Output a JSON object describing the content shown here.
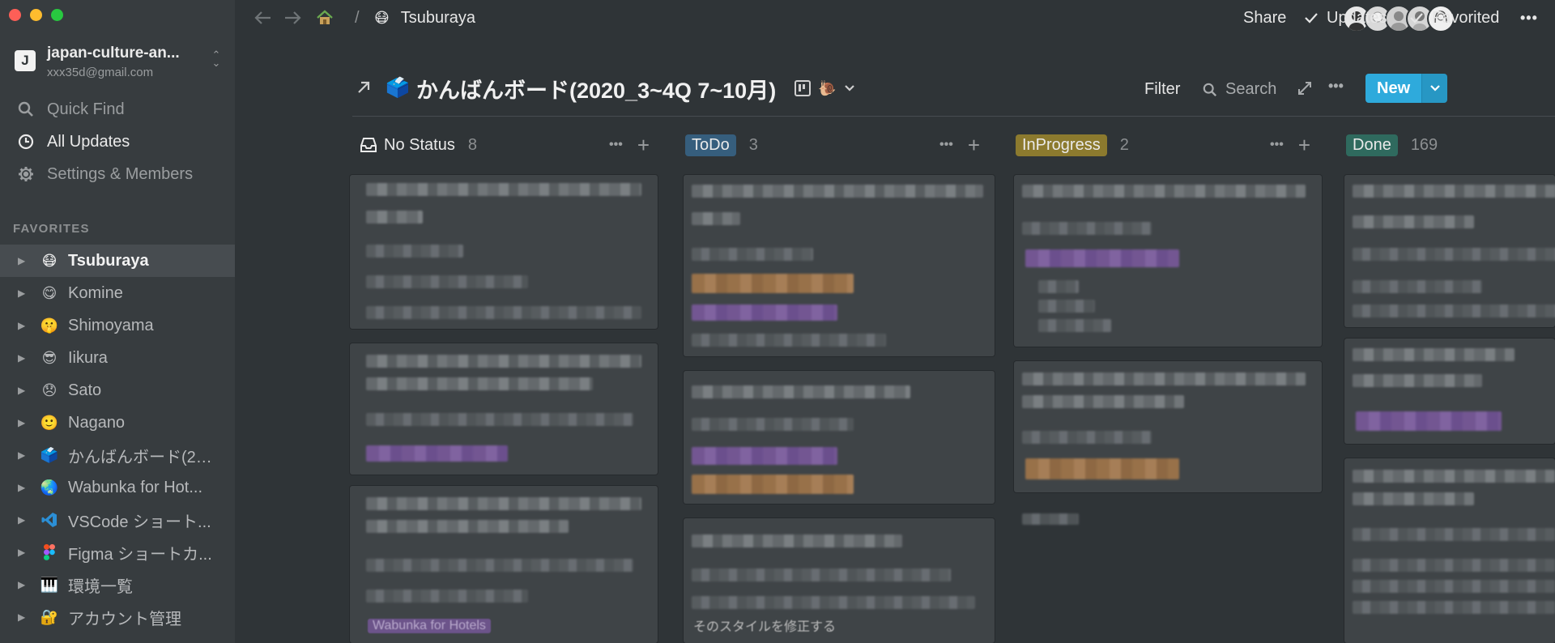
{
  "workspace": {
    "name": "japan-culture-an...",
    "email": "xxx35d@gmail.com",
    "icon_letter": "J"
  },
  "sidebar_nav": [
    {
      "label": "Quick Find",
      "icon": "search-icon"
    },
    {
      "label": "All Updates",
      "icon": "clock-icon"
    },
    {
      "label": "Settings & Members",
      "icon": "gear-icon"
    }
  ],
  "favorites_heading": "FAVORITES",
  "favorites": [
    {
      "label": "Tsuburaya",
      "emoji": "😷"
    },
    {
      "label": "Komine",
      "emoji": "😋"
    },
    {
      "label": "Shimoyama",
      "emoji": "🤫"
    },
    {
      "label": "Iikura",
      "emoji": "😎"
    },
    {
      "label": "Sato",
      "emoji": "😞"
    },
    {
      "label": "Nagano",
      "emoji": "🙂"
    },
    {
      "label": "かんばんボード(20...",
      "emoji": "🗳️"
    },
    {
      "label": "Wabunka for Hot...",
      "emoji": "🌏"
    },
    {
      "label": "VSCode ショート...",
      "emoji": "vscode-logo"
    },
    {
      "label": "Figma ショートカ...",
      "emoji": "figma-logo"
    },
    {
      "label": "環境一覧",
      "emoji": "🎹"
    },
    {
      "label": "アカウント管理",
      "emoji": "🔐"
    }
  ],
  "topbar": {
    "breadcrumb_sep": "/",
    "page_emoji": "😷",
    "page_name": "Tsuburaya",
    "share": "Share",
    "updates": "Updates",
    "favorited": "Favorited",
    "more": "•••"
  },
  "database": {
    "icon": "🗳️",
    "title": "かんばんボード(2020_3~4Q 7~10月)",
    "view_emoji": "🐌",
    "filter": "Filter",
    "search": "Search",
    "new_button": "New"
  },
  "columns": [
    {
      "name": "No Status",
      "count": "8",
      "color": ""
    },
    {
      "name": "ToDo",
      "count": "3",
      "color": "#365e7d"
    },
    {
      "name": "InProgress",
      "count": "2",
      "color": "#8c7a2e"
    },
    {
      "name": "Done",
      "count": "169",
      "color": "#2f6a5e"
    }
  ],
  "visible_fragments": {
    "nostatus_card3_tag": "Wabunka for Hotels",
    "todo_card3_text": "そのスタイルを修正する"
  }
}
